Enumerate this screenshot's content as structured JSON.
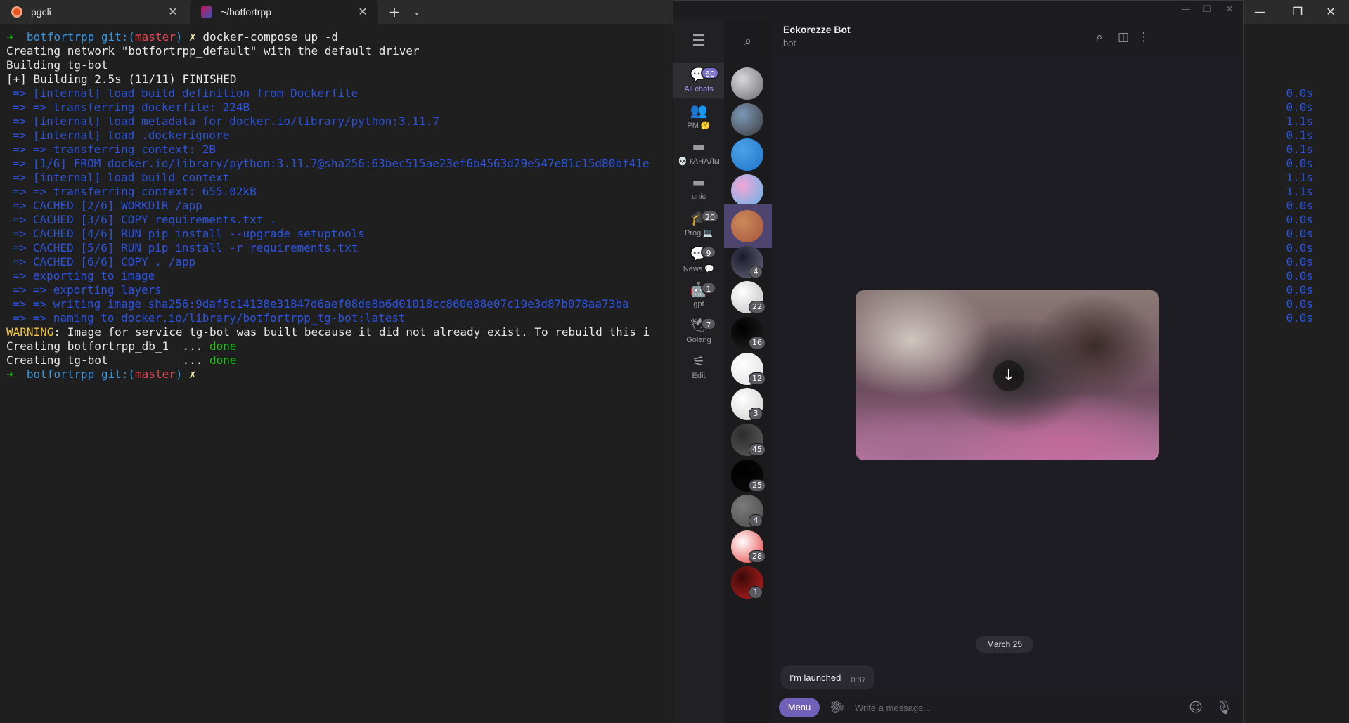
{
  "terminal": {
    "tabs": [
      {
        "label": "pgcli"
      },
      {
        "label": "~/botfortrpp"
      }
    ],
    "new_tab_glyph": "+",
    "dropdown_glyph": "⌄",
    "controls": {
      "minimize": "—",
      "maximize": "❐",
      "close": "✕"
    },
    "prompt": {
      "arrow": "➜",
      "dir": "botfortrpp",
      "git_prefix": "git:(",
      "branch": "master",
      "git_suffix": ")",
      "dirty": "✗"
    },
    "command": "docker-compose up -d",
    "output": [
      "Creating network \"botfortrpp_default\" with the default driver",
      "Building tg-bot",
      "[+] Building 2.5s (11/11) FINISHED"
    ],
    "build_steps": [
      "=> [internal] load build definition from Dockerfile",
      "=> => transferring dockerfile: 224B",
      "=> [internal] load metadata for docker.io/library/python:3.11.7",
      "=> [internal] load .dockerignore",
      "=> => transferring context: 2B",
      "=> [1/6] FROM docker.io/library/python:3.11.7@sha256:63bec515ae23ef6b4563d29e547e81c15d80bf41e",
      "=> [internal] load build context",
      "=> => transferring context: 655.02kB",
      "=> CACHED [2/6] WORKDIR /app",
      "=> CACHED [3/6] COPY requirements.txt .",
      "=> CACHED [4/6] RUN pip install --upgrade setuptools",
      "=> CACHED [5/6] RUN pip install -r requirements.txt",
      "=> CACHED [6/6] COPY . /app",
      "=> exporting to image",
      "=> => exporting layers",
      "=> => writing image sha256:9daf5c14138e31847d6aef08de8b6d01018cc860e88e07c19e3d87b078aa73ba",
      "=> => naming to docker.io/library/botfortrpp_tg-bot:latest"
    ],
    "step_times": [
      "0.0s",
      "0.0s",
      "1.1s",
      "0.1s",
      "0.1s",
      "0.0s",
      "1.1s",
      "1.1s",
      "0.0s",
      "0.0s",
      "0.0s",
      "0.0s",
      "0.0s",
      "0.0s",
      "0.0s",
      "0.0s",
      "0.0s"
    ],
    "warning_label": "WARNING",
    "warning_text": ": Image for service tg-bot was built because it did not already exist. To rebuild this i",
    "creating": [
      {
        "text": "Creating botfortrpp_db_1  ... ",
        "status": "done"
      },
      {
        "text": "Creating tg-bot           ... ",
        "status": "done"
      }
    ]
  },
  "telegram": {
    "window_controls": {
      "minimize": "—",
      "maximize": "☐",
      "close": "✕"
    },
    "folders": [
      {
        "label": "All chats",
        "badge": "60",
        "icon": "chat-bubbles-icon",
        "glyph": "💬"
      },
      {
        "label": "PM 🤔",
        "badge": "",
        "icon": "people-icon",
        "glyph": "👥"
      },
      {
        "label": "💀 кАНАЛы",
        "badge": "",
        "icon": "folder-icon",
        "glyph": "▬"
      },
      {
        "label": "unic",
        "badge": "",
        "icon": "folder-icon",
        "glyph": "▬"
      },
      {
        "label": "Prog 💻",
        "badge": "20",
        "icon": "graduation-cap-icon",
        "glyph": "🎓"
      },
      {
        "label": "News 💬",
        "badge": "9",
        "icon": "chat-bubbles-icon",
        "glyph": "💬"
      },
      {
        "label": "gpt",
        "badge": "1",
        "icon": "robot-icon",
        "glyph": "🤖"
      },
      {
        "label": "Golang",
        "badge": "7",
        "icon": "bird-icon",
        "glyph": "🕊"
      },
      {
        "label": "Edit",
        "badge": "",
        "icon": "sliders-icon",
        "glyph": "⚟"
      }
    ],
    "chats": [
      {
        "badge": "",
        "colors": [
          "#d8d8dc",
          "#6a6a70"
        ]
      },
      {
        "badge": "",
        "colors": [
          "#7d98b8",
          "#3a3a3a"
        ]
      },
      {
        "badge": "",
        "colors": [
          "#4da3e8",
          "#1e73c8"
        ]
      },
      {
        "badge": "",
        "colors": [
          "#f2a7d7",
          "#5fb4e8"
        ]
      },
      {
        "badge": "",
        "colors": [
          "#c98a5a",
          "#a8543c"
        ]
      },
      {
        "badge": "4",
        "colors": [
          "#1a1a2a",
          "#6a6a80"
        ]
      },
      {
        "badge": "22",
        "colors": [
          "#ffffff",
          "#bcbcbc"
        ]
      },
      {
        "badge": "16",
        "colors": [
          "#000000",
          "#222222"
        ]
      },
      {
        "badge": "12",
        "colors": [
          "#ffffff",
          "#dddddd"
        ]
      },
      {
        "badge": "3",
        "colors": [
          "#ffffff",
          "#cccccc"
        ]
      },
      {
        "badge": "45",
        "colors": [
          "#2c2c2c",
          "#606060"
        ]
      },
      {
        "badge": "25",
        "colors": [
          "#000000",
          "#0a0a0a"
        ]
      },
      {
        "badge": "4",
        "colors": [
          "#7a7a7a",
          "#4a4a4a"
        ]
      },
      {
        "badge": "28",
        "colors": [
          "#ffffff",
          "#e33b3b"
        ]
      },
      {
        "badge": "1",
        "colors": [
          "#3a0a0a",
          "#c02020"
        ]
      }
    ],
    "header": {
      "title": "Eckorezze Bot",
      "subtitle": "bot"
    },
    "date_separator": "March 25",
    "message": {
      "text": "I'm launched",
      "time": "0:37"
    },
    "composer": {
      "menu_label": "Menu",
      "placeholder": "Write a message..."
    }
  }
}
